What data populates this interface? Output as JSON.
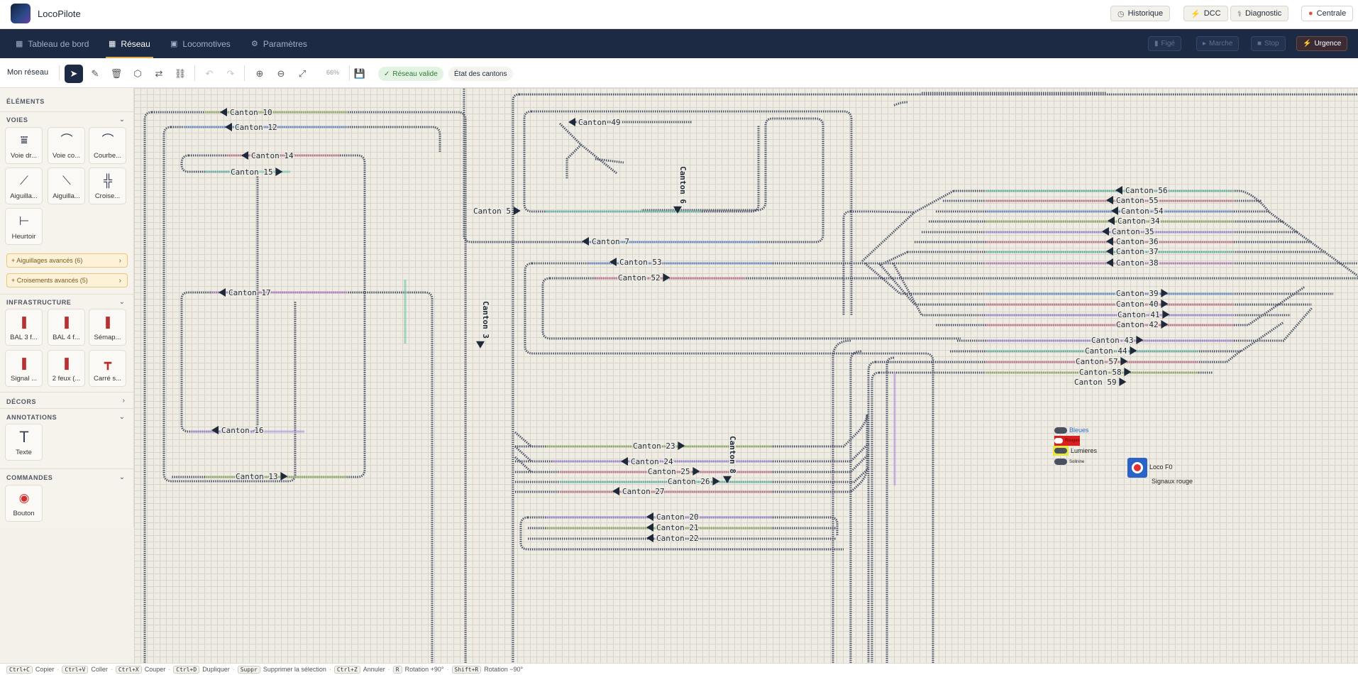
{
  "app": {
    "title": "LocoPilote"
  },
  "header": {
    "buttons": [
      {
        "label": "Historique",
        "icon": "history-icon"
      },
      {
        "label": "DCC",
        "icon": "dcc-icon"
      },
      {
        "label": "Diagnostic",
        "icon": "diagnostic-icon"
      },
      {
        "label": "Centrale",
        "icon": "status-dot-icon"
      }
    ]
  },
  "nav": {
    "tabs": [
      {
        "label": "Tableau de bord",
        "active": false
      },
      {
        "label": "Réseau",
        "active": true
      },
      {
        "label": "Locomotives",
        "active": false
      },
      {
        "label": "Paramètres",
        "active": false
      }
    ],
    "controls": [
      {
        "label": "Figé"
      },
      {
        "label": "Marche"
      },
      {
        "label": "Stop"
      },
      {
        "label": "Urgence"
      }
    ]
  },
  "toolbar": {
    "network_name": "Mon réseau",
    "zoom": "66%",
    "valid_label": "Réseau valide",
    "states_label": "État des cantons"
  },
  "sidebar": {
    "title": "ÉLÉMENTS",
    "sections": {
      "voies": "VOIES",
      "infrastructure": "INFRASTRUCTURE",
      "decors": "DÉCORS",
      "annotations": "ANNOTATIONS",
      "commandes": "COMMANDES"
    },
    "voies_tiles": [
      {
        "label": "Voie dr..."
      },
      {
        "label": "Voie co..."
      },
      {
        "label": "Courbe..."
      },
      {
        "label": "Aiguilla..."
      },
      {
        "label": "Aiguilla..."
      },
      {
        "label": "Croise..."
      },
      {
        "label": "Heurtoir"
      }
    ],
    "advanced": [
      {
        "label": "+ Aiguillages avancés (6)"
      },
      {
        "label": "+ Croisements avancés (5)"
      }
    ],
    "infra_tiles": [
      {
        "label": "BAL 3 f..."
      },
      {
        "label": "BAL 4 f..."
      },
      {
        "label": "Sémap..."
      },
      {
        "label": "Signal ..."
      },
      {
        "label": "2 feux (..."
      },
      {
        "label": "Carré s..."
      }
    ],
    "annotation_tiles": [
      {
        "label": "Texte"
      }
    ],
    "command_tiles": [
      {
        "label": "Bouton"
      }
    ]
  },
  "canvas": {
    "cantons": [
      "Canton 10",
      "Canton 12",
      "Canton 14",
      "Canton 15",
      "Canton 17",
      "Canton 16",
      "Canton 13",
      "Canton 49",
      "Canton 5",
      "Canton 7",
      "Canton 53",
      "Canton 52",
      "Canton 3",
      "Canton 6",
      "Canton 23",
      "Canton 24",
      "Canton 25",
      "Canton 26",
      "Canton 27",
      "Canton 20",
      "Canton 21",
      "Canton 22",
      "Canton 8",
      "Canton 56",
      "Canton 55",
      "Canton 54",
      "Canton 34",
      "Canton 35",
      "Canton 36",
      "Canton 37",
      "Canton 38",
      "Canton 39",
      "Canton 40",
      "Canton 41",
      "Canton 42",
      "Canton 43",
      "Canton 44",
      "Canton 57",
      "Canton 58",
      "Canton 59"
    ],
    "toggles": [
      {
        "label": "Bleues"
      },
      {
        "label": "Rouges"
      },
      {
        "label": "Lumieres"
      },
      {
        "label": "Sollnine"
      }
    ],
    "loco_button": {
      "label": "Loco F0"
    },
    "annotation": "Signaux rouge"
  },
  "statusbar": {
    "shortcuts": [
      {
        "key": "Ctrl+C",
        "label": "Copier"
      },
      {
        "key": "Ctrl+V",
        "label": "Coller"
      },
      {
        "key": "Ctrl+X",
        "label": "Couper"
      },
      {
        "key": "Ctrl+D",
        "label": "Dupliquer"
      },
      {
        "key": "Suppr",
        "label": "Supprimer la sélection"
      },
      {
        "key": "Ctrl+Z",
        "label": "Annuler"
      },
      {
        "key": "R",
        "label": "Rotation +90°"
      },
      {
        "key": "Shift+R",
        "label": "Rotation −90°"
      }
    ]
  },
  "colors": {
    "navbar": "#1c2a44",
    "accent": "#e0a94a",
    "valid": "#2f7a35",
    "urgent": "#e25a3a",
    "track": "#4a5368"
  }
}
